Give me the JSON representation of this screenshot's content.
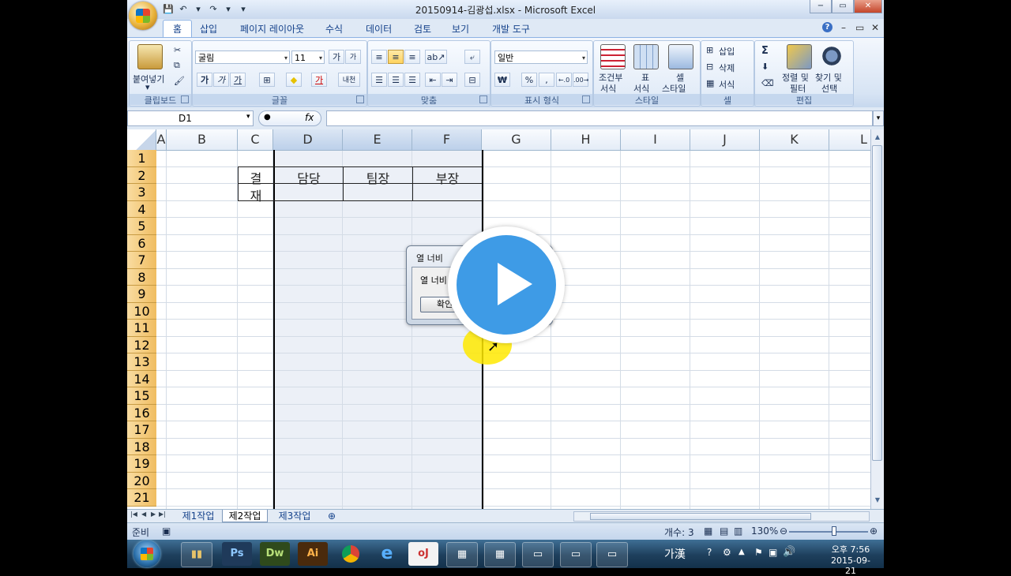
{
  "window": {
    "title": "20150914-김광섭.xlsx - Microsoft Excel",
    "controls": {
      "minimize": "−",
      "restore": "▭",
      "close": "✕"
    }
  },
  "quick_access": {
    "save": "💾",
    "undo": "↶",
    "redo": "↷",
    "customize": "▾"
  },
  "tabs": [
    "홈",
    "삽입",
    "페이지 레이아웃",
    "수식",
    "데이터",
    "검토",
    "보기",
    "개발 도구"
  ],
  "active_tab": "홈",
  "ribbon": {
    "clipboard": {
      "paste_label": "붙여넣기",
      "group_label": "클립보드"
    },
    "font": {
      "font_name": "굴림",
      "font_size": "11",
      "grow": "가",
      "shrink": "가",
      "bold": "가",
      "italic": "가",
      "underline": "가",
      "border": "⊞",
      "fill": "◆",
      "font_color": "가",
      "phonetic": "내천",
      "group_label": "글꼴"
    },
    "alignment": {
      "group_label": "맞춤"
    },
    "number": {
      "format": "일반",
      "currency": "₩",
      "percent": "%",
      "comma": ",",
      "inc": "←.0",
      "dec": ".00→",
      "group_label": "표시 형식"
    },
    "styles": {
      "conditional_line1": "조건부",
      "conditional_line2": "서식",
      "table_line1": "표",
      "table_line2": "서식",
      "cell_line1": "셀",
      "cell_line2": "스타일",
      "group_label": "스타일"
    },
    "cells": {
      "insert": "삽입",
      "delete": "삭제",
      "format": "서식",
      "group_label": "셀"
    },
    "editing": {
      "sum": "Σ",
      "sort_line1": "정렬 및",
      "sort_line2": "필터",
      "find_line1": "찾기 및",
      "find_line2": "선택",
      "group_label": "편집"
    }
  },
  "formula_bar": {
    "name_box": "D1",
    "fx": "fx",
    "value": ""
  },
  "columns": [
    "A",
    "B",
    "C",
    "D",
    "E",
    "F",
    "G",
    "H",
    "I",
    "J",
    "K",
    "L"
  ],
  "selected_columns": [
    "D",
    "E",
    "F"
  ],
  "rows": [
    "1",
    "2",
    "3",
    "4",
    "5",
    "6",
    "7",
    "8",
    "9",
    "10",
    "11",
    "12",
    "13",
    "14",
    "15",
    "16",
    "17",
    "18",
    "19",
    "20",
    "21"
  ],
  "cells": {
    "C2": "결",
    "C3": "재",
    "D2": "담당",
    "E2": "팀장",
    "F2": "부장"
  },
  "dialog": {
    "title": "열 너비",
    "label": "열 너비",
    "ok": "확인"
  },
  "sheets": [
    "제1작업",
    "제2작업",
    "제3작업"
  ],
  "active_sheet": "제2작업",
  "status": {
    "mode": "준비",
    "count": "개수: 3",
    "zoom": "130%"
  },
  "taskbar": {
    "apps": [
      "Ps",
      "Dw",
      "Ai"
    ],
    "ime": "가漢",
    "time": "오후 7:56",
    "date": "2015-09-21"
  },
  "colors": {
    "accent": "#3e9be6",
    "row_header": "#f4c878",
    "ribbon_bg": "#dfe9f5"
  }
}
